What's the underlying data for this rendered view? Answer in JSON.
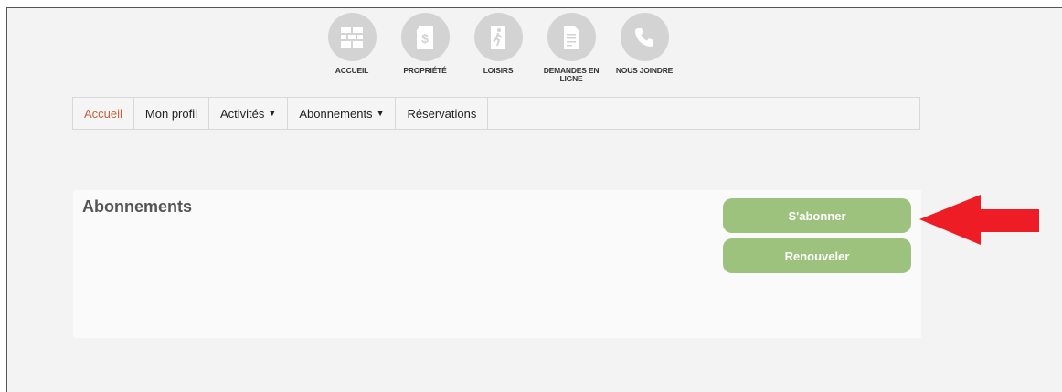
{
  "top_nav": [
    {
      "label": "ACCUEIL",
      "icon": "home-grid-icon"
    },
    {
      "label": "PROPRIÉTÉ",
      "icon": "property-tag-icon"
    },
    {
      "label": "LOISIRS",
      "icon": "leisure-person-icon"
    },
    {
      "label": "DEMANDES EN LIGNE",
      "icon": "document-icon"
    },
    {
      "label": "NOUS JOINDRE",
      "icon": "phone-icon"
    }
  ],
  "menu": {
    "accueil": "Accueil",
    "profil": "Mon profil",
    "activites": "Activités",
    "abonnements": "Abonnements",
    "reservations": "Réservations",
    "caret": "▼"
  },
  "panel": {
    "title": "Abonnements",
    "subscribe_label": "S'abonner",
    "renew_label": "Renouveler"
  },
  "colors": {
    "active_tab": "#c0623a",
    "button_green": "#9cc27d",
    "arrow_red": "#ee1c24",
    "icon_circle": "#d3d3d3"
  }
}
